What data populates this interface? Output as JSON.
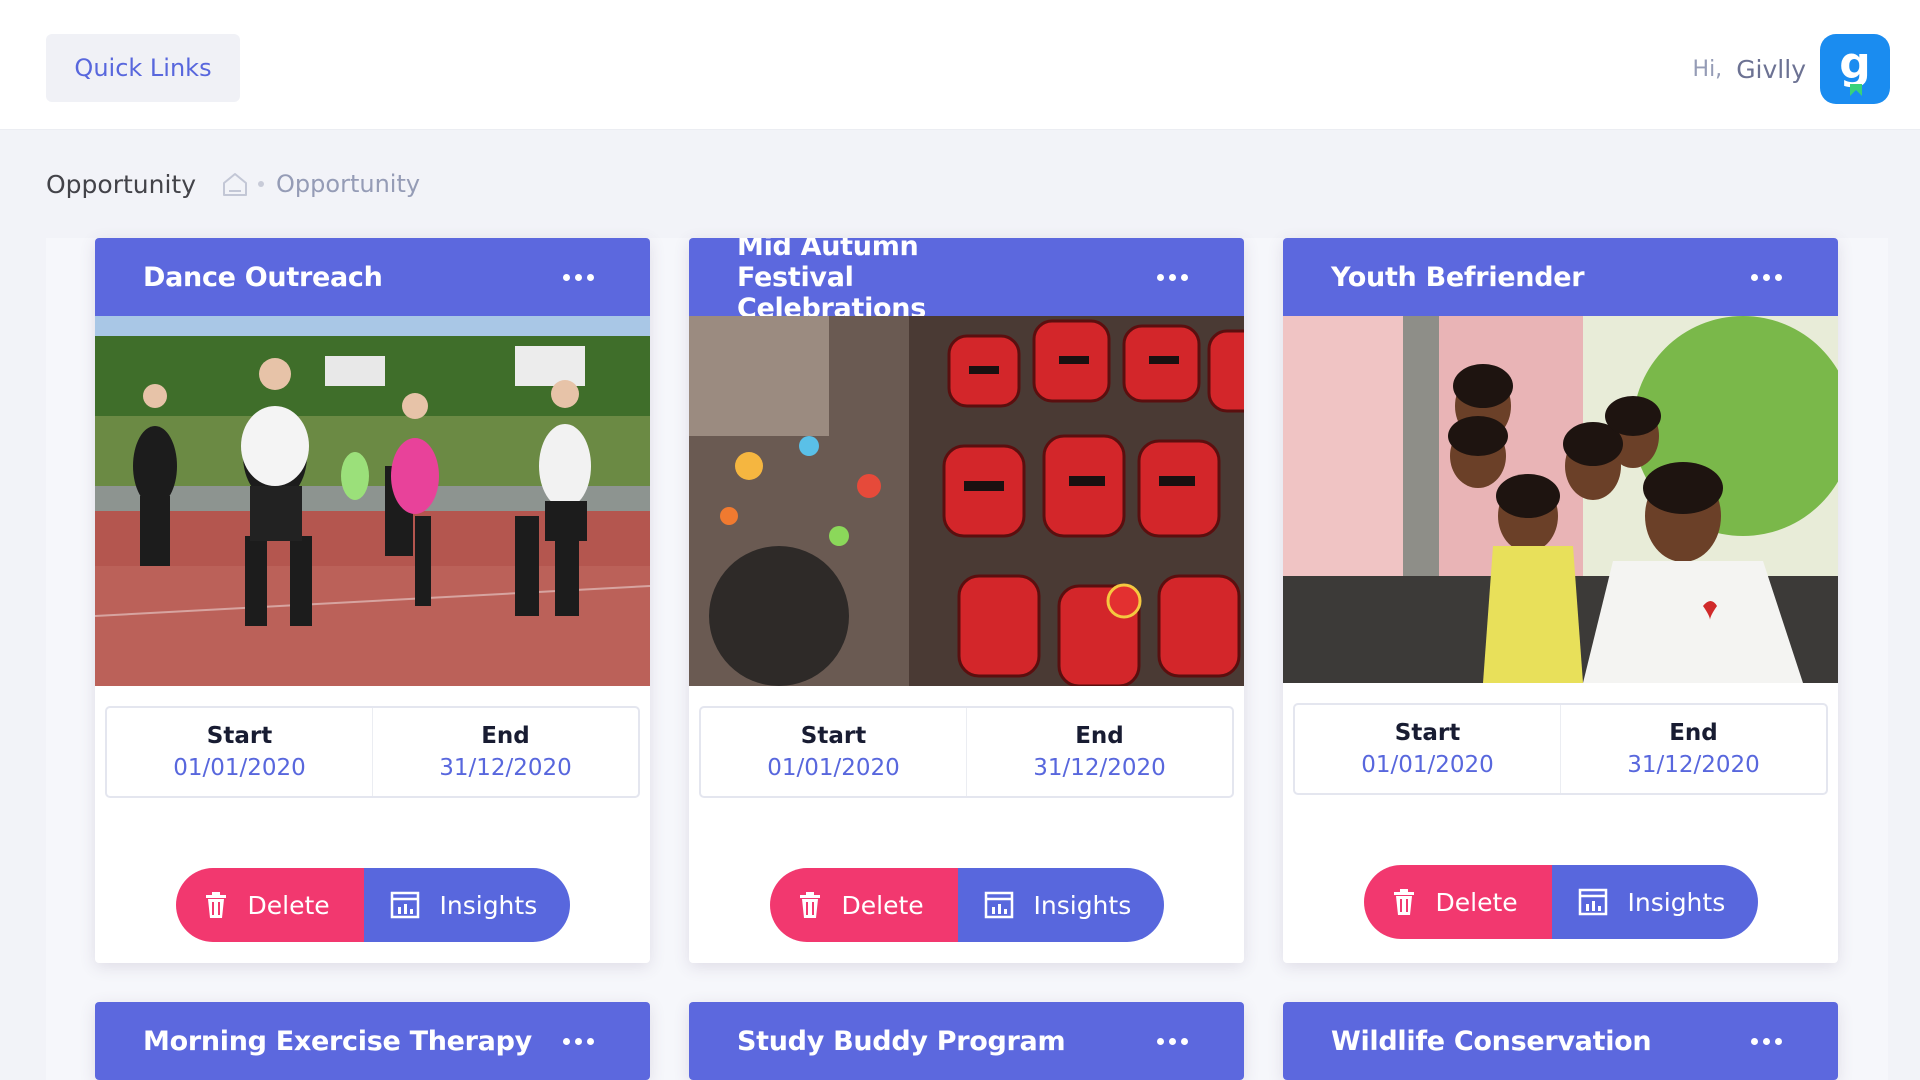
{
  "topbar": {
    "quick_links_label": "Quick Links",
    "greeting": "Hi,",
    "user_name": "Givlly",
    "avatar_letter": "g"
  },
  "subheader": {
    "title": "Opportunity",
    "breadcrumb_link": "Opportunity"
  },
  "labels": {
    "start": "Start",
    "end": "End",
    "delete": "Delete",
    "insights": "Insights"
  },
  "cards": [
    {
      "title": "Dance Outreach",
      "start": "01/01/2020",
      "end": "31/12/2020"
    },
    {
      "title": "Mid Autumn Festival Celebrations",
      "start": "01/01/2020",
      "end": "31/12/2020"
    },
    {
      "title": "Youth Befriender",
      "start": "01/01/2020",
      "end": "31/12/2020"
    },
    {
      "title": "Morning Exercise Therapy"
    },
    {
      "title": "Study Buddy Program"
    },
    {
      "title": "Wildlife Conservation"
    }
  ],
  "colors": {
    "accent": "#5867dd",
    "card_header": "#5c68de",
    "delete": "#f2386f",
    "avatar": "#1a8cf0"
  }
}
